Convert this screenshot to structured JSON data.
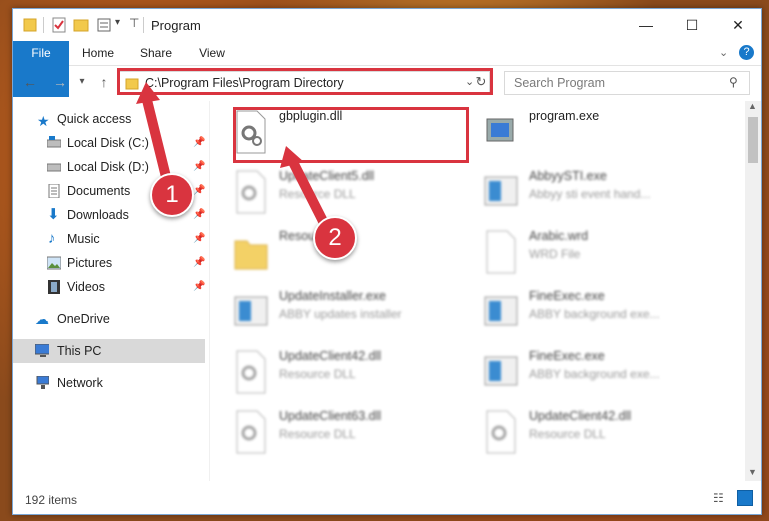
{
  "window": {
    "title": "Program"
  },
  "ribbon": {
    "tabs": [
      "File",
      "Home",
      "Share",
      "View"
    ]
  },
  "address": {
    "path": "C:\\Program Files\\Program Directory"
  },
  "search": {
    "placeholder": "Search Program"
  },
  "nav": {
    "items": [
      {
        "label": "Quick access",
        "icon": "star-icon",
        "pinned": false
      },
      {
        "label": "Local Disk (C:)",
        "icon": "drive-icon",
        "pinned": true
      },
      {
        "label": "Local Disk (D:)",
        "icon": "drive-icon",
        "pinned": true
      },
      {
        "label": "Documents",
        "icon": "documents-icon",
        "pinned": true
      },
      {
        "label": "Downloads",
        "icon": "download-icon",
        "pinned": true
      },
      {
        "label": "Music",
        "icon": "music-icon",
        "pinned": true
      },
      {
        "label": "Pictures",
        "icon": "pictures-icon",
        "pinned": true
      },
      {
        "label": "Videos",
        "icon": "videos-icon",
        "pinned": true
      },
      {
        "label": "OneDrive",
        "icon": "cloud-icon",
        "pinned": false
      },
      {
        "label": "This PC",
        "icon": "computer-icon",
        "pinned": false
      },
      {
        "label": "Network",
        "icon": "network-icon",
        "pinned": false
      }
    ]
  },
  "files": [
    {
      "name": "gbplugin.dll",
      "desc": "",
      "icon": "gear-file-icon"
    },
    {
      "name": "program.exe",
      "desc": "",
      "icon": "exe-icon"
    },
    {
      "name": "UpdateClient5.dll",
      "desc": "Resource DLL",
      "icon": "gear-file-icon"
    },
    {
      "name": "AbbyySTI.exe",
      "desc": "Abbyy sti event hand...",
      "icon": "window-icon"
    },
    {
      "name": "Resources",
      "desc": "",
      "icon": "folder-icon"
    },
    {
      "name": "Arabic.wrd",
      "desc": "WRD File",
      "icon": "blank-file-icon"
    },
    {
      "name": "UpdateInstaller.exe",
      "desc": "ABBY updates installer",
      "icon": "window-icon"
    },
    {
      "name": "FineExec.exe",
      "desc": "ABBY background exe...",
      "icon": "window-icon"
    },
    {
      "name": "UpdateClient42.dll",
      "desc": "Resource DLL",
      "icon": "gear-file-icon"
    },
    {
      "name": "FineExec.exe",
      "desc": "ABBY background exe...",
      "icon": "window-icon"
    },
    {
      "name": "UpdateClient63.dll",
      "desc": "Resource DLL",
      "icon": "gear-file-icon"
    },
    {
      "name": "UpdateClient42.dll",
      "desc": "Resource DLL",
      "icon": "gear-file-icon"
    }
  ],
  "status": {
    "count": "192 items"
  },
  "callouts": {
    "one": "1",
    "two": "2"
  },
  "colors": {
    "accent": "#1979ca",
    "highlight": "#d9343f",
    "selected": "#d9d9d9"
  }
}
